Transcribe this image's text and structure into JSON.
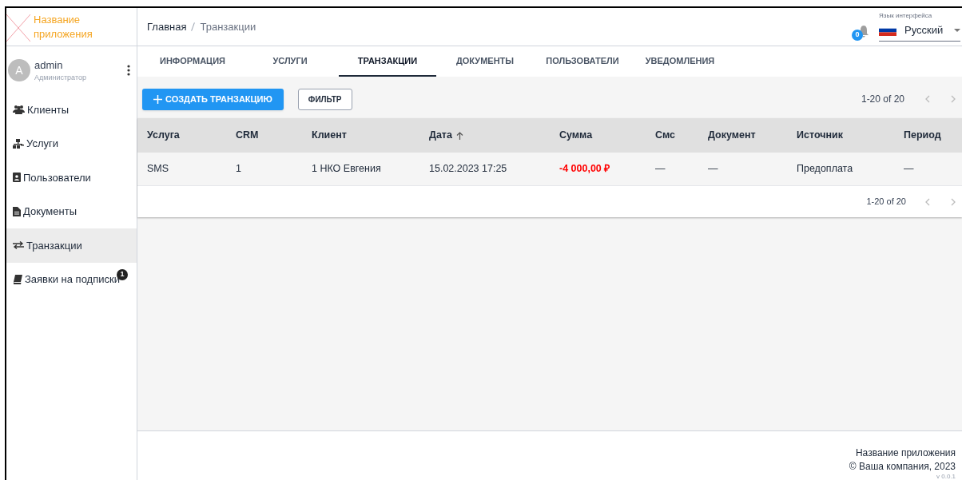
{
  "app": {
    "name": "Название приложения"
  },
  "user": {
    "initial": "A",
    "name": "admin",
    "role": "Администратор"
  },
  "sidebar": {
    "items": [
      {
        "label": "Клиенты",
        "selected": false
      },
      {
        "label": "Услуги",
        "selected": false
      },
      {
        "label": "Пользователи",
        "selected": false
      },
      {
        "label": "Документы",
        "selected": false
      },
      {
        "label": "Транзакции",
        "selected": true
      },
      {
        "label": "Заявки на подписки",
        "selected": false,
        "badge": "1"
      }
    ]
  },
  "breadcrumb": [
    "Главная",
    "Транзакции"
  ],
  "notifications": {
    "count": "0"
  },
  "language": {
    "label": "Язык интерфейса",
    "value": "Русский"
  },
  "tabs": [
    {
      "label": "ИНФОРМАЦИЯ",
      "selected": false
    },
    {
      "label": "УСЛУГИ",
      "selected": false
    },
    {
      "label": "ТРАНЗАКЦИИ",
      "selected": true
    },
    {
      "label": "ДОКУМЕНТЫ",
      "selected": false
    },
    {
      "label": "ПОЛЬЗОВАТЕЛИ",
      "selected": false
    },
    {
      "label": "УВЕДОМЛЕНИЯ",
      "selected": false
    }
  ],
  "toolbar": {
    "create_button": "СОЗДАТЬ ТРАНЗАКЦИЮ",
    "filter_button": "ФИЛЬТР",
    "pagination": "1-20 of 20"
  },
  "table": {
    "columns": [
      {
        "label": "Услуга"
      },
      {
        "label": "CRM"
      },
      {
        "label": "Клиент"
      },
      {
        "label": "Дата",
        "sorted_ascending": true
      },
      {
        "label": "Сумма"
      },
      {
        "label": "Смс"
      },
      {
        "label": "Документ"
      },
      {
        "label": "Источник"
      },
      {
        "label": "Период"
      }
    ],
    "rows": [
      {
        "cells": [
          "SMS",
          "1",
          "1 НКО Евгения",
          "15.02.2023 17:25",
          "-4 000,00 ₽",
          "—",
          "—",
          "Предоплата",
          "—"
        ],
        "amount_negative": true
      }
    ],
    "pagination": "1-20 of 20"
  },
  "footer": {
    "app_name": "Название приложения",
    "copyright": "© Ваша компания, 2023",
    "version": "v 0.0.1"
  }
}
